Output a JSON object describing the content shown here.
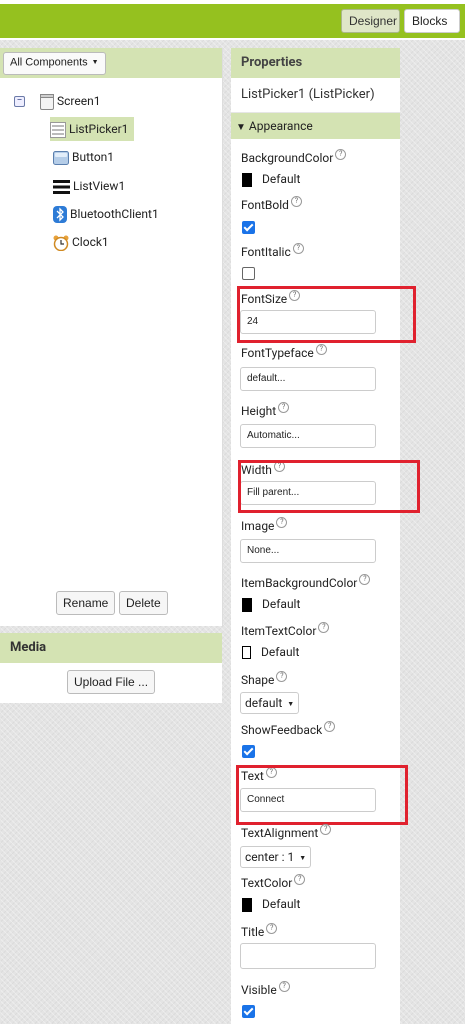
{
  "toolbar": {
    "designer_label": "Designer",
    "blocks_label": "Blocks"
  },
  "components": {
    "dropdown_label": "All Components",
    "tree": [
      {
        "label": "Screen1",
        "icon": "screen-icon"
      },
      {
        "label": "ListPicker1",
        "icon": "listpicker-icon",
        "selected": true
      },
      {
        "label": "Button1",
        "icon": "button-icon"
      },
      {
        "label": "ListView1",
        "icon": "listview-icon"
      },
      {
        "label": "BluetoothClient1",
        "icon": "bluetooth-icon"
      },
      {
        "label": "Clock1",
        "icon": "clock-icon"
      }
    ],
    "rename_label": "Rename",
    "delete_label": "Delete"
  },
  "media": {
    "title": "Media",
    "upload_label": "Upload File ..."
  },
  "properties": {
    "title": "Properties",
    "component": "ListPicker1 (ListPicker)",
    "section": "Appearance",
    "background_color": {
      "label": "BackgroundColor",
      "value": "Default",
      "color": "#000000"
    },
    "font_bold": {
      "label": "FontBold",
      "checked": true
    },
    "font_italic": {
      "label": "FontItalic",
      "checked": false
    },
    "font_size": {
      "label": "FontSize",
      "value": "24"
    },
    "font_typeface": {
      "label": "FontTypeface",
      "value": "default..."
    },
    "height": {
      "label": "Height",
      "value": "Automatic..."
    },
    "width": {
      "label": "Width",
      "value": "Fill parent..."
    },
    "image": {
      "label": "Image",
      "value": "None..."
    },
    "item_background_color": {
      "label": "ItemBackgroundColor",
      "value": "Default",
      "color": "#000000"
    },
    "item_text_color": {
      "label": "ItemTextColor",
      "value": "Default",
      "color": "#ffffff"
    },
    "shape": {
      "label": "Shape",
      "value": "default"
    },
    "show_feedback": {
      "label": "ShowFeedback",
      "checked": true
    },
    "text": {
      "label": "Text",
      "value": "Connect"
    },
    "text_alignment": {
      "label": "TextAlignment",
      "value": "center : 1"
    },
    "text_color": {
      "label": "TextColor",
      "value": "Default",
      "color": "#000000"
    },
    "title_prop": {
      "label": "Title",
      "value": ""
    },
    "visible": {
      "label": "Visible",
      "checked": true
    }
  },
  "colors": {
    "accent_green": "#95c11f",
    "panel_header": "#d4e3b3",
    "highlight_red": "#e0212e",
    "checkbox_blue": "#1a73e8"
  }
}
